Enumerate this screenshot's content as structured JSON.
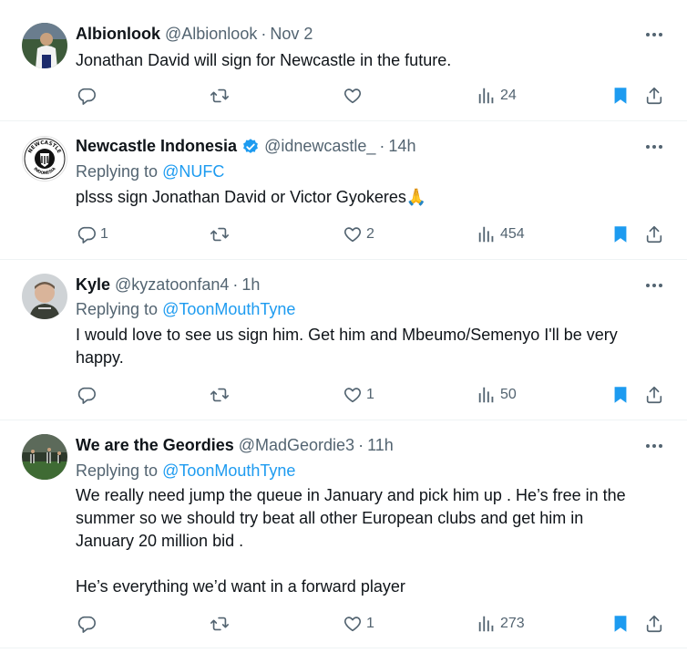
{
  "tweets": [
    {
      "name": "Albionlook",
      "handle": "@Albionlook",
      "sep": "·",
      "time": "Nov 2",
      "verified": false,
      "replying_label": "",
      "replying_to": "",
      "lines": [
        "Jonathan David will sign for Newcastle in the future."
      ],
      "replies": "",
      "reposts": "",
      "likes": "",
      "views": "24",
      "bookmarked": true
    },
    {
      "name": "Newcastle Indonesia",
      "handle": "@idnewcastle_",
      "sep": "·",
      "time": "14h",
      "verified": true,
      "avatar_text_top": "NEWCASTLE",
      "avatar_text_bottom": "INDONESIA",
      "replying_label": "Replying to",
      "replying_to": "@NUFC",
      "lines": [
        "plsss sign Jonathan David or Victor Gyokeres🙏"
      ],
      "replies": "1",
      "reposts": "",
      "likes": "2",
      "views": "454",
      "bookmarked": true
    },
    {
      "name": "Kyle",
      "handle": "@kyzatoonfan4",
      "sep": "·",
      "time": "1h",
      "verified": false,
      "replying_label": "Replying to",
      "replying_to": "@ToonMouthTyne",
      "lines": [
        "I would love to see us sign him. Get him and Mbeumo/Semenyo I'll be very",
        "happy."
      ],
      "replies": "",
      "reposts": "",
      "likes": "1",
      "views": "50",
      "bookmarked": true
    },
    {
      "name": "We are the Geordies",
      "handle": "@MadGeordie3",
      "sep": "·",
      "time": "11h",
      "verified": false,
      "replying_label": "Replying to",
      "replying_to": "@ToonMouthTyne",
      "lines": [
        "We really need jump the queue in January and pick him up . He’s free in the",
        "summer so we should try beat all other European clubs and get him in",
        "January 20 million bid ."
      ],
      "lines2": [
        "He’s everything we’d want in a forward player"
      ],
      "replies": "",
      "reposts": "",
      "likes": "1",
      "views": "273",
      "bookmarked": true
    }
  ],
  "colors": {
    "text": "#0f1419",
    "secondary": "#536471",
    "link": "#1d9bf0",
    "divider": "#eff3f4"
  },
  "icons": [
    "more-icon",
    "reply-icon",
    "repost-icon",
    "like-icon",
    "views-icon",
    "bookmark-icon",
    "share-icon",
    "verified-icon"
  ]
}
